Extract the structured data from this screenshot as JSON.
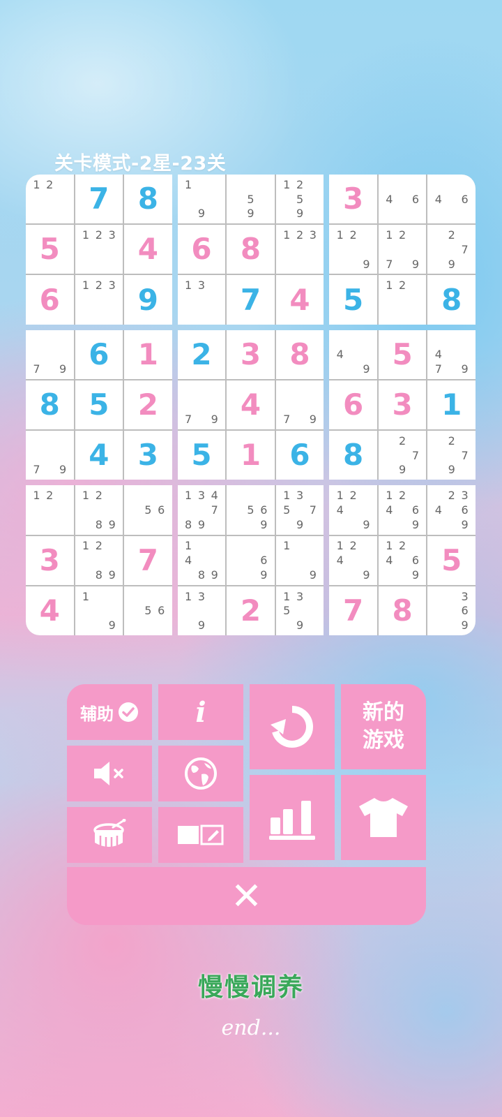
{
  "header": {
    "title": "关卡模式-2星-23关"
  },
  "colors": {
    "blue": "#3bb3e6",
    "pink": "#f28cbf",
    "button": "#f59ac8"
  },
  "board": [
    [
      {
        "n": "12"
      },
      {
        "v": "7",
        "c": "blue"
      },
      {
        "v": "8",
        "c": "blue"
      },
      {
        "n": "1,,,,,,,9"
      },
      {
        "n": ",,,,5,,,9"
      },
      {
        "n": "12,,,5,,,9"
      },
      {
        "v": "3",
        "c": "pink"
      },
      {
        "n": ",,,4,,6"
      },
      {
        "n": ",,,4,,6"
      }
    ],
    [
      {
        "v": "5",
        "c": "pink"
      },
      {
        "n": "123"
      },
      {
        "v": "4",
        "c": "pink"
      },
      {
        "v": "6",
        "c": "pink"
      },
      {
        "v": "8",
        "c": "pink"
      },
      {
        "n": "123"
      },
      {
        "n": "12,,,,,,,9"
      },
      {
        "n": "12,,,,,7,,9"
      },
      {
        "n": ",2,,,,7,,9"
      }
    ],
    [
      {
        "v": "6",
        "c": "pink"
      },
      {
        "n": "123"
      },
      {
        "v": "9",
        "c": "blue"
      },
      {
        "n": "1,3"
      },
      {
        "v": "7",
        "c": "blue"
      },
      {
        "v": "4",
        "c": "pink"
      },
      {
        "v": "5",
        "c": "blue"
      },
      {
        "n": "12"
      },
      {
        "v": "8",
        "c": "blue"
      }
    ],
    [
      {
        "n": ",,,,,,7,,9"
      },
      {
        "v": "6",
        "c": "blue"
      },
      {
        "v": "1",
        "c": "pink"
      },
      {
        "v": "2",
        "c": "blue"
      },
      {
        "v": "3",
        "c": "pink"
      },
      {
        "v": "8",
        "c": "pink"
      },
      {
        "n": ",,,4,,,,,9"
      },
      {
        "v": "5",
        "c": "pink"
      },
      {
        "n": ",,,4,,,7,,9"
      }
    ],
    [
      {
        "v": "8",
        "c": "blue"
      },
      {
        "v": "5",
        "c": "blue"
      },
      {
        "v": "2",
        "c": "pink"
      },
      {
        "n": ",,,,,,7,,9"
      },
      {
        "v": "4",
        "c": "pink"
      },
      {
        "n": ",,,,,,7,,9"
      },
      {
        "v": "6",
        "c": "pink"
      },
      {
        "v": "3",
        "c": "pink"
      },
      {
        "v": "1",
        "c": "blue"
      }
    ],
    [
      {
        "n": ",,,,,,7,,9"
      },
      {
        "v": "4",
        "c": "blue"
      },
      {
        "v": "3",
        "c": "blue"
      },
      {
        "v": "5",
        "c": "blue"
      },
      {
        "v": "1",
        "c": "pink"
      },
      {
        "v": "6",
        "c": "blue"
      },
      {
        "v": "8",
        "c": "blue"
      },
      {
        "n": ",2,,,,7,,9"
      },
      {
        "n": ",2,,,,7,,9"
      }
    ],
    [
      {
        "n": "12"
      },
      {
        "n": "12,,,,,,89"
      },
      {
        "n": ",,,,56"
      },
      {
        "n": "1,3,4,,,789"
      },
      {
        "n": ",,,,56,,,9"
      },
      {
        "n": "1,3,,5,,7,,9"
      },
      {
        "n": "12,,4,,,,,9"
      },
      {
        "n": "12,,4,,6,,,9"
      },
      {
        "n": ",23,4,,6,,,9"
      }
    ],
    [
      {
        "v": "3",
        "c": "pink"
      },
      {
        "n": "12,,,,,,89"
      },
      {
        "v": "7",
        "c": "pink"
      },
      {
        "n": "1,,,4,,,,89"
      },
      {
        "n": ",,,,,6,,,9"
      },
      {
        "n": "1,,,,,,,,9"
      },
      {
        "n": "12,,4,,,,,9"
      },
      {
        "n": "12,,4,,6,,,9"
      },
      {
        "v": "5",
        "c": "pink"
      }
    ],
    [
      {
        "v": "4",
        "c": "pink"
      },
      {
        "n": "1,,,,,,,,9"
      },
      {
        "n": ",,,,56"
      },
      {
        "n": "1,3,,,,,,9"
      },
      {
        "v": "2",
        "c": "pink"
      },
      {
        "n": "1,3,,5,,,,9"
      },
      {
        "v": "7",
        "c": "pink"
      },
      {
        "v": "8",
        "c": "pink"
      },
      {
        "n": ",,3,,,6,,,9"
      }
    ]
  ],
  "menu": {
    "assist_label": "辅助",
    "info_label": "i",
    "new_game_line1": "新的",
    "new_game_line2": "游戏",
    "icons": {
      "assist": "check-circle-icon",
      "info": "info-icon",
      "restart": "restart-icon",
      "mute": "speaker-mute-icon",
      "language": "globe-icon",
      "sound": "drum-icon",
      "notes": "note-edit-icon",
      "stats": "bar-chart-icon",
      "theme": "t-shirt-icon",
      "close": "close-icon"
    },
    "close_label": "✕"
  },
  "footer": {
    "caption": "慢慢调养",
    "end": "end..."
  }
}
